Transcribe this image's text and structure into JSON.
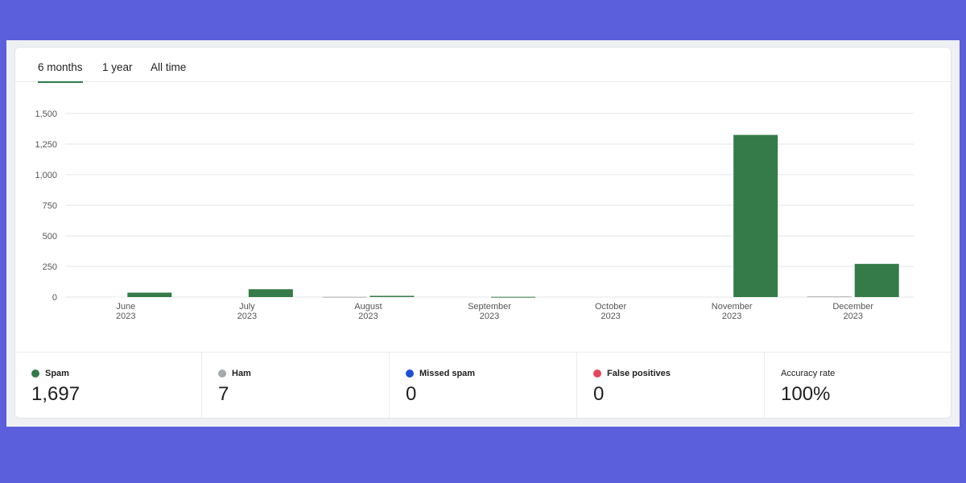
{
  "tabs": [
    {
      "label": "6 months",
      "active": true
    },
    {
      "label": "1 year",
      "active": false
    },
    {
      "label": "All time",
      "active": false
    }
  ],
  "chart_data": {
    "type": "bar",
    "categories": [
      [
        "June",
        "2023"
      ],
      [
        "July",
        "2023"
      ],
      [
        "August",
        "2023"
      ],
      [
        "September",
        "2023"
      ],
      [
        "October",
        "2023"
      ],
      [
        "November",
        "2023"
      ],
      [
        "December",
        "2023"
      ]
    ],
    "series": [
      {
        "name": "Ham",
        "color": "#a7aaad",
        "values": [
          0,
          0,
          2,
          0,
          0,
          0,
          5
        ]
      },
      {
        "name": "Spam",
        "color": "#357b49",
        "values": [
          36,
          64,
          10,
          2,
          0,
          1325,
          271
        ]
      }
    ],
    "y_ticks": [
      "0",
      "250",
      "500",
      "750",
      "1,000",
      "1,250",
      "1,500"
    ],
    "ylim": [
      0,
      1500
    ],
    "grid": true
  },
  "stats": [
    {
      "label": "Spam",
      "value": "1,697",
      "color": "#357b49"
    },
    {
      "label": "Ham",
      "value": "7",
      "color": "#a7aaad"
    },
    {
      "label": "Missed spam",
      "value": "0",
      "color": "#1d50d4"
    },
    {
      "label": "False positives",
      "value": "0",
      "color": "#e5475c"
    },
    {
      "label": "Accuracy rate",
      "value": "100%"
    }
  ]
}
